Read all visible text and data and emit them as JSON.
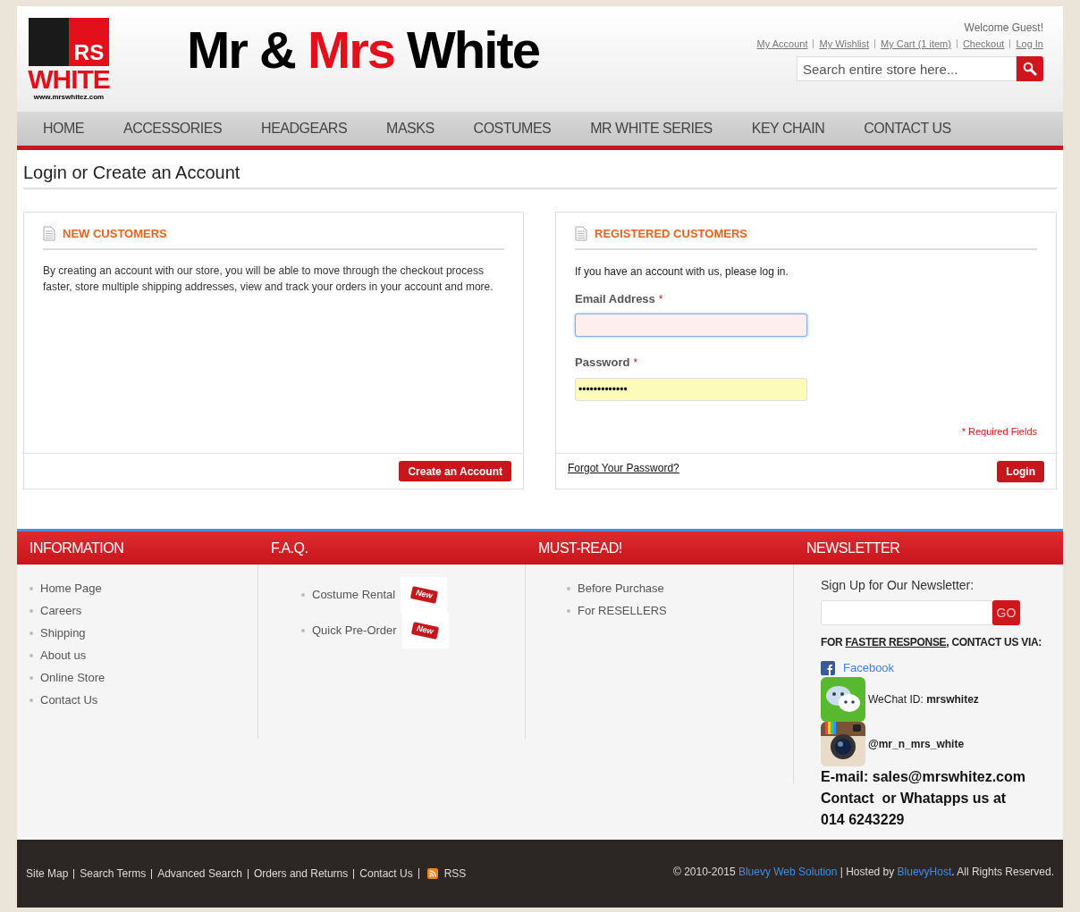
{
  "header": {
    "logo": {
      "mark": "RS",
      "word": "WHITE",
      "url": "www.mrswhitez.com"
    },
    "title_parts": [
      {
        "text": "Mr &",
        "accent": false
      },
      {
        "text": "Mrs",
        "accent": true
      },
      {
        "text": "White",
        "accent": false
      }
    ],
    "welcome": "Welcome Guest!",
    "links": [
      "My Account",
      "My Wishlist",
      "My Cart (1 item)",
      "Checkout",
      "Log In"
    ],
    "search": {
      "placeholder": "Search entire store here..."
    }
  },
  "nav": [
    "HOME",
    "ACCESSORIES",
    "HEADGEARS",
    "MASKS",
    "COSTUMES",
    "MR WHITE SERIES",
    "KEY CHAIN",
    "CONTACT US"
  ],
  "page_title": "Login or Create an Account",
  "new_customers": {
    "title": "NEW CUSTOMERS",
    "text": "By creating an account with our store, you will be able to move through the checkout process faster, store multiple shipping addresses, view and track your orders in your account and more.",
    "button": "Create an Account"
  },
  "registered_customers": {
    "title": "REGISTERED CUSTOMERS",
    "intro": "If you have an account with us, please log in.",
    "fields": [
      {
        "label": "Email Address",
        "required_mark": "*",
        "focused": true
      },
      {
        "label": "Password",
        "required_mark": "*",
        "value": "•••••••••••••",
        "focused": false
      }
    ],
    "required_note": "* Required Fields",
    "forgot": "Forgot Your Password?",
    "button": "Login"
  },
  "footer_columns": [
    {
      "title": "INFORMATION",
      "items": [
        {
          "label": "Home Page",
          "new": false
        },
        {
          "label": "Careers",
          "new": false
        },
        {
          "label": "Shipping",
          "new": false
        },
        {
          "label": "About us",
          "new": false
        },
        {
          "label": "Online Store",
          "new": false
        },
        {
          "label": "Contact Us",
          "new": false
        }
      ]
    },
    {
      "title": "F.A.Q.",
      "items": [
        {
          "label": "Costume Rental",
          "new": true,
          "tag": "New"
        },
        {
          "label": "Quick Pre-Order",
          "new": true,
          "tag": "New"
        }
      ]
    },
    {
      "title": "MUST-READ!",
      "items": [
        {
          "label": "Before Purchase",
          "new": false
        },
        {
          "label": "For RESELLERS",
          "new": false
        }
      ]
    }
  ],
  "newsletter": {
    "title": "NEWSLETTER",
    "label": "Sign Up for Our Newsletter:",
    "button": "GO",
    "contact_heading": {
      "before": "FOR ",
      "underlined": "FASTER RESPONSE",
      "after": ", CONTACT US VIA:"
    },
    "contacts": [
      {
        "kind": "facebook",
        "text": "Facebook"
      },
      {
        "kind": "wechat",
        "text": "WeChat ID: **mrswhitez**"
      },
      {
        "kind": "instagram",
        "text": "@mr_n_mrs_white"
      }
    ],
    "lines": [
      "E-mail: sales@mrswhitez.com",
      "Contact  or Whatapps us at",
      "014 6243229"
    ]
  },
  "bottom_links": [
    "Site Map",
    "Search Terms",
    "Advanced Search",
    "Orders and Returns",
    "Contact Us",
    "RSS"
  ],
  "copyright": [
    {
      "text": "© 2010-2015 ",
      "link": false
    },
    {
      "text": "Bluevy Web Solution",
      "link": true
    },
    {
      "text": " | Hosted by ",
      "link": false
    },
    {
      "text": "BluevyHost",
      "link": true
    },
    {
      "text": ". All Rights Reserved.",
      "link": false
    }
  ]
}
